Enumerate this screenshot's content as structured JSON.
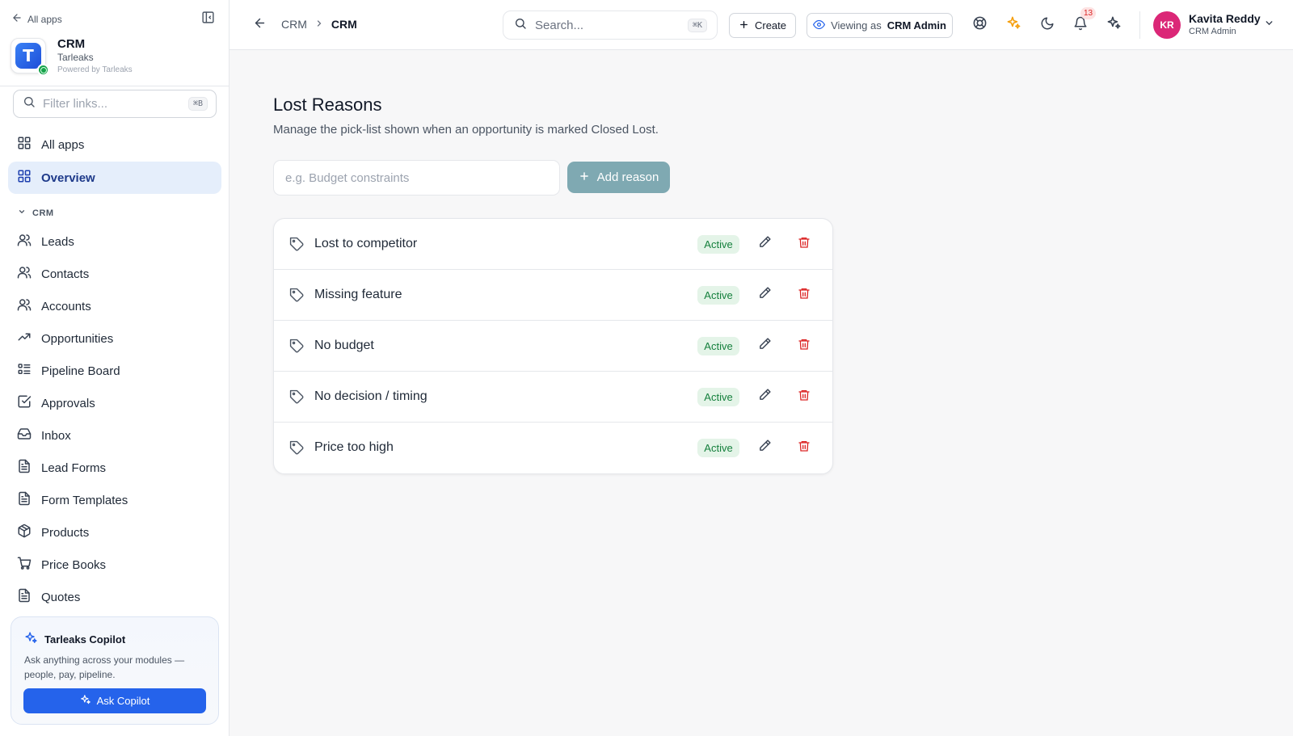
{
  "sidebar": {
    "back_label": "All apps",
    "app": {
      "name": "CRM",
      "org": "Tarleaks",
      "powered_by": "Powered by Tarleaks",
      "logo_letter": "T"
    },
    "filter": {
      "placeholder": "Filter links...",
      "shortcut": "⌘B"
    },
    "top_items": [
      {
        "label": "All apps",
        "icon": "grid-icon",
        "active": false
      },
      {
        "label": "Overview",
        "icon": "grid-icon",
        "active": true
      }
    ],
    "section_label": "CRM",
    "items": [
      {
        "label": "Leads",
        "icon": "users-icon"
      },
      {
        "label": "Contacts",
        "icon": "users-icon"
      },
      {
        "label": "Accounts",
        "icon": "users-icon"
      },
      {
        "label": "Opportunities",
        "icon": "trending-up-icon"
      },
      {
        "label": "Pipeline Board",
        "icon": "board-icon"
      },
      {
        "label": "Approvals",
        "icon": "check-square-icon"
      },
      {
        "label": "Inbox",
        "icon": "inbox-icon"
      },
      {
        "label": "Lead Forms",
        "icon": "file-text-icon"
      },
      {
        "label": "Form Templates",
        "icon": "file-text-icon"
      },
      {
        "label": "Products",
        "icon": "package-icon"
      },
      {
        "label": "Price Books",
        "icon": "cart-icon"
      },
      {
        "label": "Quotes",
        "icon": "file-text-icon"
      }
    ],
    "copilot": {
      "title": "Tarleaks Copilot",
      "description": "Ask anything across your modules — people, pay, pipeline.",
      "button_label": "Ask Copilot"
    }
  },
  "header": {
    "breadcrumb": [
      "CRM",
      "CRM"
    ],
    "search": {
      "placeholder": "Search...",
      "shortcut": "⌘K"
    },
    "create_label": "Create",
    "viewing_as_prefix": "Viewing as",
    "viewing_as_role": "CRM Admin",
    "notification_count": "13",
    "user": {
      "initials": "KR",
      "name": "Kavita Reddy",
      "role": "CRM Admin"
    }
  },
  "main": {
    "title": "Lost Reasons",
    "subtitle": "Manage the pick-list shown when an opportunity is marked Closed Lost.",
    "input_placeholder": "e.g. Budget constraints",
    "add_button_label": "Add reason",
    "reasons": [
      {
        "name": "Lost to competitor",
        "status": "Active"
      },
      {
        "name": "Missing feature",
        "status": "Active"
      },
      {
        "name": "No budget",
        "status": "Active"
      },
      {
        "name": "No decision / timing",
        "status": "Active"
      },
      {
        "name": "Price too high",
        "status": "Active"
      }
    ]
  },
  "colors": {
    "primary": "#2563eb",
    "active_nav_bg": "#e5eefb",
    "status_active_bg": "#e4f4e8",
    "status_active_text": "#15803d",
    "delete_icon": "#dc2626",
    "add_button_bg": "#7fa9b2",
    "avatar_bg": "#db2777",
    "sparkle_accent": "#f59e0b"
  }
}
